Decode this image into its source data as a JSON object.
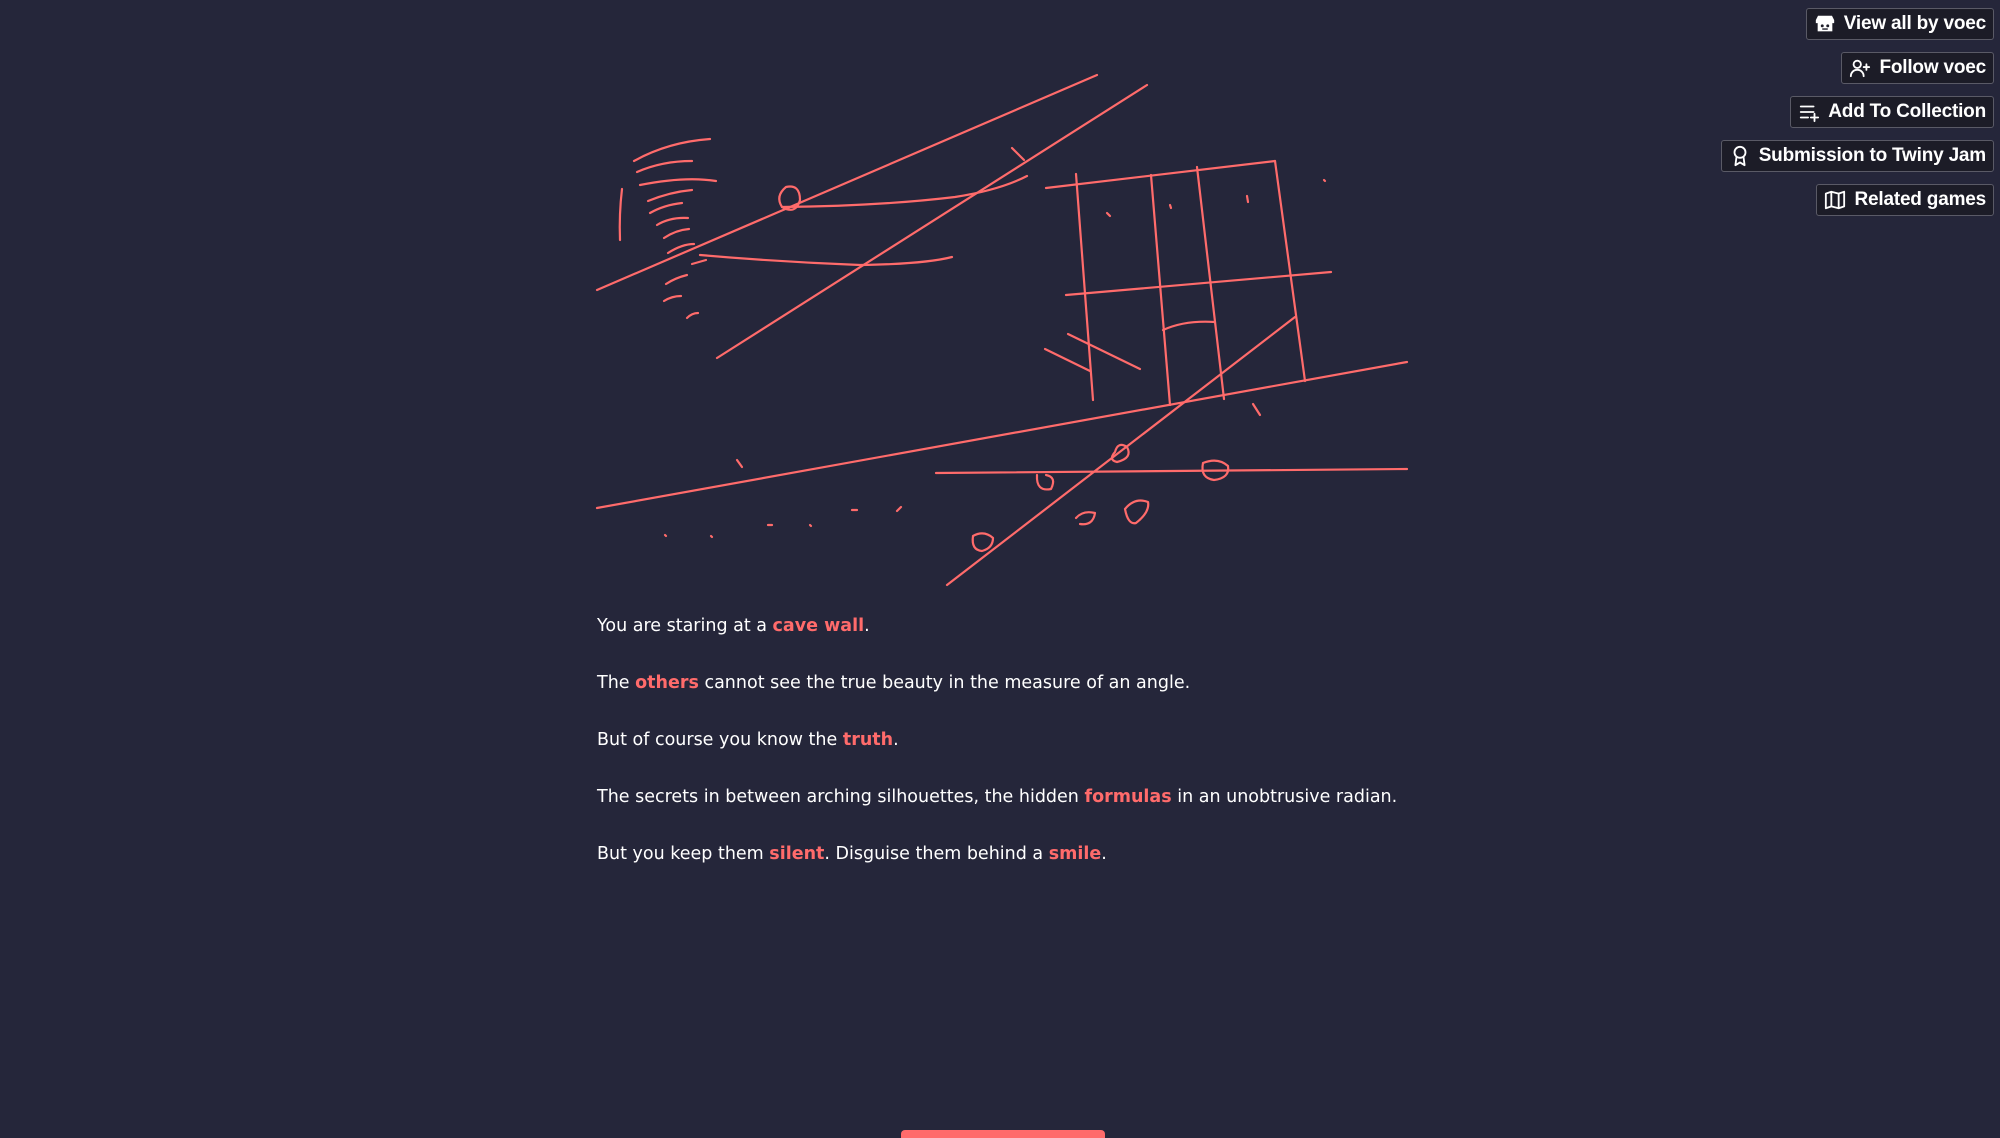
{
  "toolbar": {
    "buttons": [
      {
        "label": "View all by voec",
        "icon": "itchio-icon"
      },
      {
        "label": "Follow voec",
        "icon": "user-plus-icon"
      },
      {
        "label": "Add To Collection",
        "icon": "list-plus-icon"
      },
      {
        "label": "Submission to Twiny Jam",
        "icon": "award-ribbon-icon"
      },
      {
        "label": "Related games",
        "icon": "map-icon"
      }
    ]
  },
  "drawing": {
    "description_icon": "cave-wall-sketch",
    "stroke_color": "#ff6b6b"
  },
  "story": {
    "p1": {
      "pre": "You are staring at a ",
      "kw": "cave wall",
      "post": "."
    },
    "p2": {
      "pre": "The ",
      "kw": "others",
      "post": " cannot see the true beauty in the measure of an angle."
    },
    "p3": {
      "pre": "But of course you know the ",
      "kw": "truth",
      "post": "."
    },
    "p4": {
      "pre": "The secrets in between arching silhouettes, the hidden ",
      "kw": "formulas",
      "post": " in an unobtrusive radian."
    },
    "p5": {
      "pre": "But you keep them ",
      "kw": "silent",
      "mid": ". Disguise them behind a ",
      "kw2": "smile",
      "post": "."
    }
  },
  "colors": {
    "background": "#25263a",
    "accent": "#ff6b6b",
    "text": "#ffffff"
  }
}
